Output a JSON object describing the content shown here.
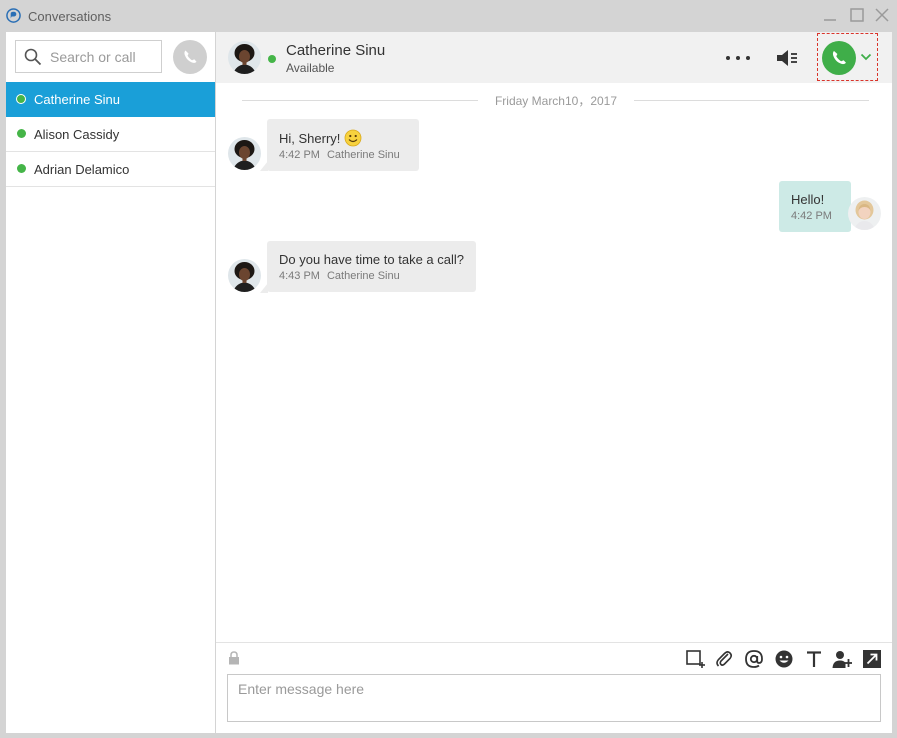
{
  "window": {
    "title": "Conversations"
  },
  "search": {
    "placeholder": "Search or call"
  },
  "contacts": [
    {
      "name": "Catherine Sinu",
      "active": true
    },
    {
      "name": "Alison Cassidy",
      "active": false
    },
    {
      "name": "Adrian Delamico",
      "active": false
    }
  ],
  "header": {
    "name": "Catherine Sinu",
    "presence": "Available"
  },
  "chat": {
    "date": "Friday March10，2017",
    "messages": [
      {
        "text": "Hi, Sherry!",
        "time": "4:42 PM",
        "sender": "Catherine Sinu",
        "emoji": "smiley-icon"
      },
      {
        "text": "Hello!",
        "time": "4:42 PM",
        "sender": ""
      },
      {
        "text": "Do you have time to take a call?",
        "time": "4:43 PM",
        "sender": "Catherine Sinu"
      }
    ]
  },
  "composer": {
    "placeholder": "Enter message here"
  },
  "colors": {
    "accent": "#1a9fd8",
    "presence": "#45b548",
    "call": "#3fae49",
    "mine_bubble": "#cdeae6",
    "focus": "#d9342b"
  },
  "icons": [
    "app-logo-icon",
    "search-icon",
    "phone-icon",
    "more-icon",
    "speaker-icon",
    "chevron-down-icon",
    "lock-icon",
    "screen-capture-icon",
    "attach-icon",
    "mention-icon",
    "emoji-icon",
    "text-format-icon",
    "add-person-icon",
    "expand-icon"
  ]
}
